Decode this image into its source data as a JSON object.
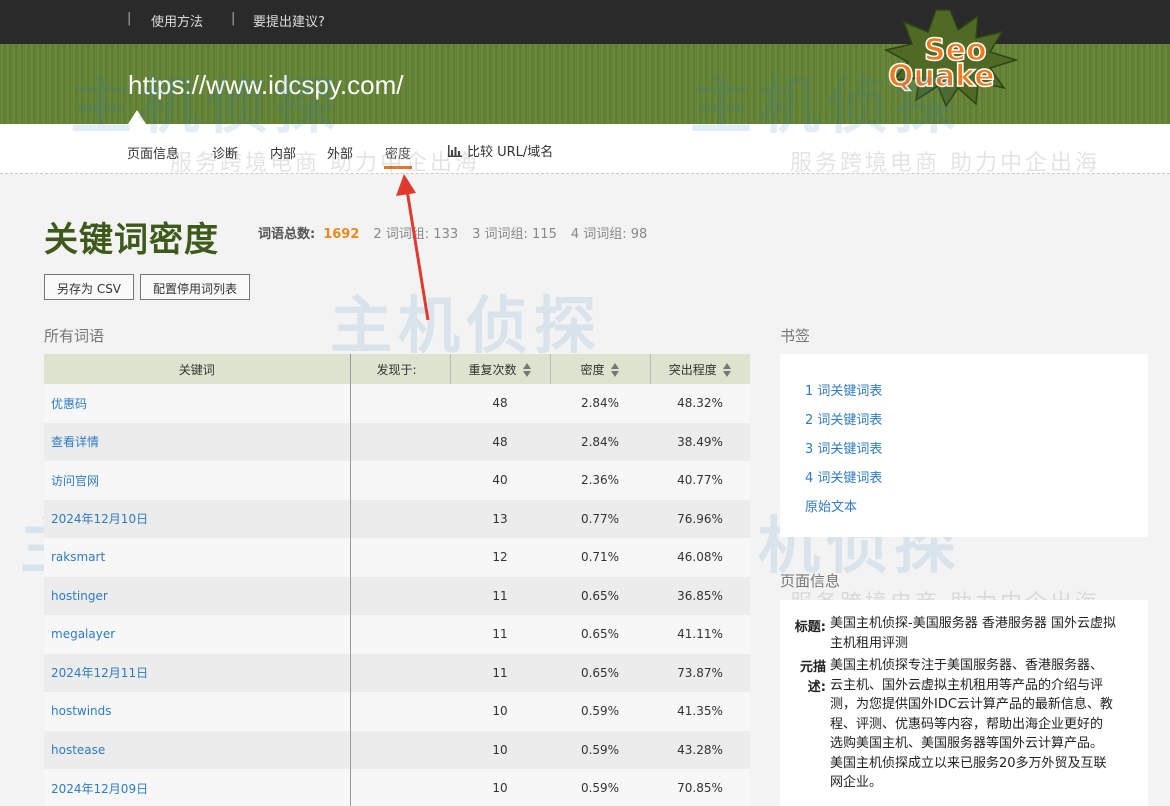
{
  "topbar": {
    "links": [
      {
        "label": "使用方法"
      },
      {
        "label": "要提出建议?"
      }
    ],
    "separator": "|"
  },
  "banner": {
    "url": "https://www.idcspy.com/",
    "logo_text_1": "Seo",
    "logo_text_2": "Quake"
  },
  "tabs": [
    {
      "label": "页面信息"
    },
    {
      "label": "诊断"
    },
    {
      "label": "内部"
    },
    {
      "label": "外部"
    },
    {
      "label": "密度",
      "active": true
    }
  ],
  "compare": {
    "label": "比较 URL/域名",
    "icon": "bar-chart-icon"
  },
  "heading": {
    "title": "关键词密度",
    "total_label": "词语总数:",
    "total_value": "1692",
    "group2": "2 词词组: 133",
    "group3": "3 词词组: 115",
    "group4": "4 词词组: 98"
  },
  "buttons": {
    "save_csv": "另存为 CSV",
    "config_stopwords": "配置停用词列表"
  },
  "table": {
    "section_title": "所有词语",
    "headers": {
      "keyword": "关键词",
      "found_in": "发现于:",
      "repeats": "重复次数",
      "density": "密度",
      "prominence": "突出程度"
    },
    "rows": [
      {
        "keyword": "优惠码",
        "repeats": "48",
        "density": "2.84%",
        "prominence": "48.32%"
      },
      {
        "keyword": "查看详情",
        "repeats": "48",
        "density": "2.84%",
        "prominence": "38.49%"
      },
      {
        "keyword": "访问官网",
        "repeats": "40",
        "density": "2.36%",
        "prominence": "40.77%"
      },
      {
        "keyword": "2024年12月10日",
        "repeats": "13",
        "density": "0.77%",
        "prominence": "76.96%"
      },
      {
        "keyword": "raksmart",
        "repeats": "12",
        "density": "0.71%",
        "prominence": "46.08%"
      },
      {
        "keyword": "hostinger",
        "repeats": "11",
        "density": "0.65%",
        "prominence": "36.85%"
      },
      {
        "keyword": "megalayer",
        "repeats": "11",
        "density": "0.65%",
        "prominence": "41.11%"
      },
      {
        "keyword": "2024年12月11日",
        "repeats": "11",
        "density": "0.65%",
        "prominence": "73.87%"
      },
      {
        "keyword": "hostwinds",
        "repeats": "10",
        "density": "0.59%",
        "prominence": "41.35%"
      },
      {
        "keyword": "hostease",
        "repeats": "10",
        "density": "0.59%",
        "prominence": "43.28%"
      },
      {
        "keyword": "2024年12月09日",
        "repeats": "10",
        "density": "0.59%",
        "prominence": "70.85%"
      }
    ]
  },
  "bookmarks": {
    "title": "书签",
    "items": [
      {
        "label": "1 词关键词表"
      },
      {
        "label": "2 词关键词表"
      },
      {
        "label": "3 词关键词表"
      },
      {
        "label": "4 词关键词表"
      },
      {
        "label": "原始文本"
      }
    ]
  },
  "page_info": {
    "title": "页面信息",
    "title_label": "标题:",
    "title_line1": "美国主机侦探-美国服务器 香港服务器 国外云虚拟",
    "title_line2": "主机租用评测",
    "desc_label_1": "元描",
    "desc_label_2": "述:",
    "desc_lines": [
      "美国主机侦探专注于美国服务器、香港服务器、",
      "云主机、国外云虚拟主机租用等产品的介绍与评",
      "测，为您提供国外IDC云计算产品的最新信息、教",
      "程、评测、优惠码等内容，帮助出海企业更好的",
      "选购美国主机、美国服务器等国外云计算产品。",
      "美国主机侦探成立以来已服务20多万外贸及互联",
      "网企业。"
    ]
  },
  "watermark": {
    "brand": "主机侦探",
    "slogan": "服务跨境电商 助力中企出海"
  },
  "colors": {
    "banner_green": "#6a8a3a",
    "heading_green": "#3e5a1a",
    "link_blue": "#2e7cc4",
    "accent_orange": "#e88a1e",
    "annotation_red": "#e03a2e"
  }
}
